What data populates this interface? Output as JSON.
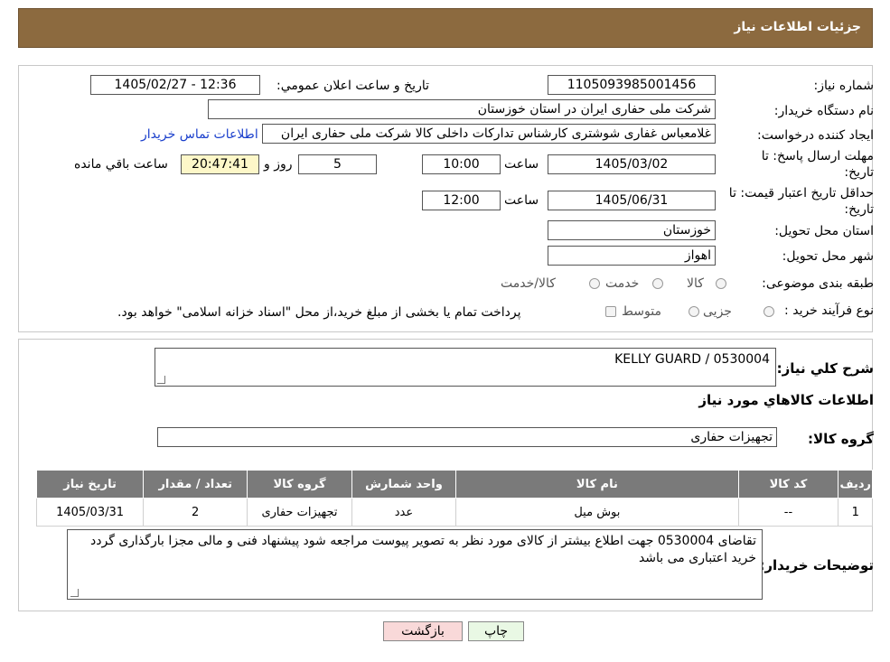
{
  "header": {
    "title": "جزئیات اطلاعات نیاز"
  },
  "form": {
    "need_number_label": "شماره نیاز:",
    "need_number": "1105093985001456",
    "announce_label": "تاريخ و ساعت اعلان عمومي:",
    "announce_value": "1405/02/27 - 12:36",
    "buyer_label": "نام دستگاه خریدار:",
    "buyer_value": "شرکت ملی حفاری ایران در استان خوزستان",
    "creator_label": "ایجاد کننده درخواست:",
    "creator_value": "غلامعباس غفاری شوشتری کارشناس تدارکات داخلی کالا شرکت ملی حفاری ایران",
    "contact_link": "اطلاعات تماس خریدار",
    "deadline_label_1": "مهلت ارسال پاسخ: تا",
    "deadline_label_2": "تاریخ:",
    "deadline_date": "1405/03/02",
    "time_label": "ساعت",
    "deadline_time": "10:00",
    "days_value": "5",
    "days_label": "روز و",
    "remaining_time": "20:47:41",
    "remaining_label": "ساعت باقي مانده",
    "validity_label_1": "حداقل تاريخ اعتبار قيمت: تا",
    "validity_label_2": "تاريخ:",
    "validity_date": "1405/06/31",
    "validity_time": "12:00",
    "province_label": "استان محل تحویل:",
    "province_value": "خوزستان",
    "city_label": "شهر محل تحویل:",
    "city_value": "اهواز",
    "category_label": "طبقه بندی موضوعی:",
    "category_options": [
      "کالا",
      "خدمت",
      "کالا/خدمت"
    ],
    "process_label": "نوع فرآیند خرید :",
    "process_options": [
      "جزیی",
      "متوسط"
    ],
    "process_note": "پرداخت تمام یا بخشی از مبلغ خرید،از محل \"اسناد خزانه اسلامی\" خواهد بود."
  },
  "details": {
    "summary_label": "شرح كلي نياز:",
    "summary_value": "KELLY GUARD /  0530004",
    "goods_info_title": "اطلاعات كالاهاي مورد نياز",
    "group_label": "گروه کالا:",
    "group_value": "تجهیزات حفاری",
    "table": {
      "headers": [
        "ردیف",
        "کد کالا",
        "نام کالا",
        "واحد شمارش",
        "گروه کالا",
        "تعداد / مقدار",
        "تاریخ نیاز"
      ],
      "rows": [
        [
          "1",
          "--",
          "بوش میل",
          "عدد",
          "تجهیزات حفاری",
          "2",
          "1405/03/31"
        ]
      ]
    },
    "buyer_notes_label": "توضیحات خریدار:",
    "buyer_notes": "تقاضای 0530004 جهت اطلاع بیشتر از کالای مورد نظر به تصویر پیوست مراجعه شود پیشنهاد فنی و مالی مجزا بارگذاری گردد خرید اعتباری می باشد"
  },
  "buttons": {
    "print": "چاپ",
    "back": "بازگشت"
  },
  "colors": {
    "header": "#8c6a3f",
    "back_button": "#f9d9d9",
    "print_button": "#e9f8e4",
    "remaining_bg": "#fdf7c8"
  }
}
